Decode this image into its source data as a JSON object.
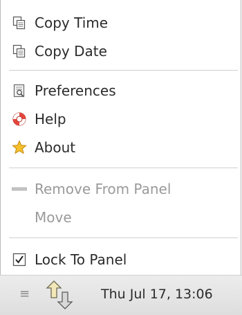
{
  "menu": {
    "items": [
      {
        "label": "Copy Time",
        "icon": "copy-icon",
        "enabled": true
      },
      {
        "label": "Copy Date",
        "icon": "copy-icon",
        "enabled": true
      },
      {
        "label": "Preferences",
        "icon": "preferences-icon",
        "enabled": true
      },
      {
        "label": "Help",
        "icon": "help-lifebuoy-icon",
        "enabled": true
      },
      {
        "label": "About",
        "icon": "star-icon",
        "enabled": true
      },
      {
        "label": "Remove From Panel",
        "icon": "remove-bar-icon",
        "enabled": false
      },
      {
        "label": "Move",
        "icon": "",
        "enabled": false
      },
      {
        "label": "Lock To Panel",
        "icon": "checkbox-icon",
        "enabled": true,
        "checked": true
      }
    ]
  },
  "panel": {
    "handle": "≡",
    "tray_icon": "up-down-arrows-icon",
    "clock_text": "Thu Jul 17, 13:06"
  },
  "colors": {
    "menu_bg": "#ffffff",
    "text": "#2b2b2b",
    "disabled_text": "#9a9a9a",
    "separator": "#cfcfcf",
    "panel_bg": "#e6e6e6",
    "star": "#f5c02c",
    "lifebuoy": "#e4473d"
  }
}
